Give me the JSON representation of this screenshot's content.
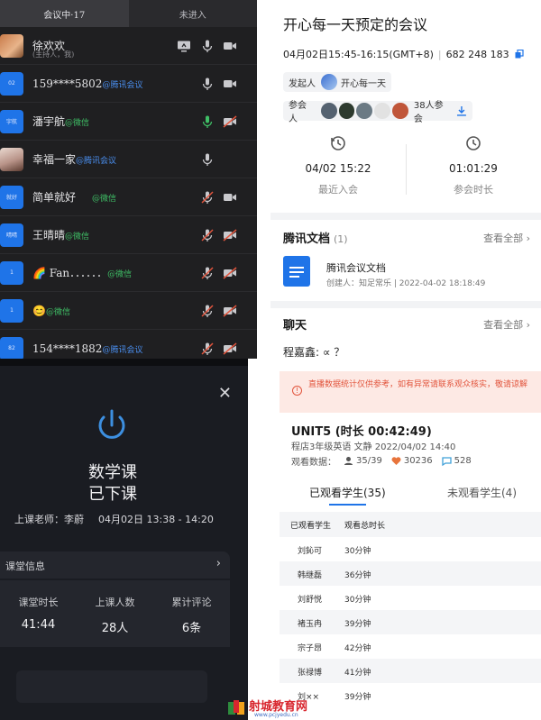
{
  "meeting_list": {
    "tabs": [
      "会议中·17",
      "未进入"
    ],
    "rows": [
      {
        "name": "徐欢欢",
        "via": "",
        "host": "(主持人，我)",
        "avatar_text": "",
        "mic": "on",
        "cam": "off",
        "share": true
      },
      {
        "name": "159****5802",
        "via": "@腾讯会议",
        "avatar_text": "02",
        "mic": "on",
        "cam": "off"
      },
      {
        "name": "潘宇航",
        "via": "@微信",
        "avatar_text": "宇航",
        "mic": "active",
        "cam": "muted"
      },
      {
        "name": "幸福一家",
        "via": "@腾讯会议",
        "avatar_text": "",
        "mic": "on",
        "cam": "none"
      },
      {
        "name": "简单就好",
        "via": "@微信",
        "avatar_text": "就好",
        "mic": "muted",
        "cam": "off"
      },
      {
        "name": "王晴晴",
        "via": "@微信",
        "avatar_text": "晴晴",
        "mic": "muted",
        "cam": "muted"
      },
      {
        "name": "🌈 Fan．．．．．．",
        "via": "@微信",
        "avatar_text": "1",
        "mic": "muted",
        "cam": "muted"
      },
      {
        "name": "😊",
        "via": "@微信",
        "avatar_text": "1",
        "mic": "muted",
        "cam": "muted"
      },
      {
        "name": "154****1882",
        "via": "@腾讯会议",
        "avatar_text": "82",
        "mic": "muted",
        "cam": "muted"
      }
    ]
  },
  "meeting_detail": {
    "title": "开心每一天预定的会议",
    "time": "04月02日15:45-16:15(GMT+8)",
    "meeting_id": "682 248 183",
    "initiator_label": "发起人",
    "initiator_name": "开心每一天",
    "participants_label": "参会人",
    "participants_count": "38人参会",
    "recent_join_value": "04/02 15:22",
    "recent_join_label": "最近入会",
    "duration_value": "01:01:29",
    "duration_label": "参会时长",
    "docs_title": "腾讯文档",
    "docs_count": "(1)",
    "view_all": "查看全部",
    "doc_name": "腾讯会议文档",
    "doc_meta": "创建人：知足常乐 | 2022-04-02 18:18:49",
    "chat_title": "聊天",
    "chat_line": "程嘉鑫: ∝ ？"
  },
  "class_ended": {
    "close": "✕",
    "course": "数学课",
    "status": "已下课",
    "teacher": "上课老师：李蔚",
    "time": "04月02日 13:38 - 14:20",
    "info_label": "课堂信息",
    "arrow": "›",
    "stats": [
      {
        "label": "课堂时长",
        "value": "41:44"
      },
      {
        "label": "上课人数",
        "value": "28人"
      },
      {
        "label": "累计评论",
        "value": "6条"
      }
    ]
  },
  "live_stats": {
    "notice_icon": "!",
    "notice": "直播数据统计仅供参考，如有异常请联系观众核实，敬请谅解",
    "title": "UNIT5 (时长 00:42:49)",
    "meta": "程店3年级英语 文静 2022/04/02 14:40",
    "watch_label": "观看数据：",
    "viewers": "35/39",
    "likes": "30236",
    "comments": "528",
    "tab_watched": "已观看学生(35)",
    "tab_unwatched": "未观看学生(4)",
    "col_student": "已观看学生",
    "col_time": "观看总时长",
    "students": [
      {
        "name": "刘鈊可",
        "time": "30分钟"
      },
      {
        "name": "韩继磊",
        "time": "36分钟"
      },
      {
        "name": "刘舒悦",
        "time": "30分钟"
      },
      {
        "name": "褚玉冉",
        "time": "39分钟"
      },
      {
        "name": "宗子昂",
        "time": "42分钟"
      },
      {
        "name": "张禄博",
        "time": "41分钟"
      },
      {
        "name": "刘××",
        "time": "39分钟"
      }
    ]
  },
  "watermark": {
    "title": "射城教育网",
    "url": "www.pcjyedu.cn"
  },
  "colors": {
    "accent": "#1f74e8",
    "alert": "#e2553d",
    "green": "#3fbf66"
  }
}
